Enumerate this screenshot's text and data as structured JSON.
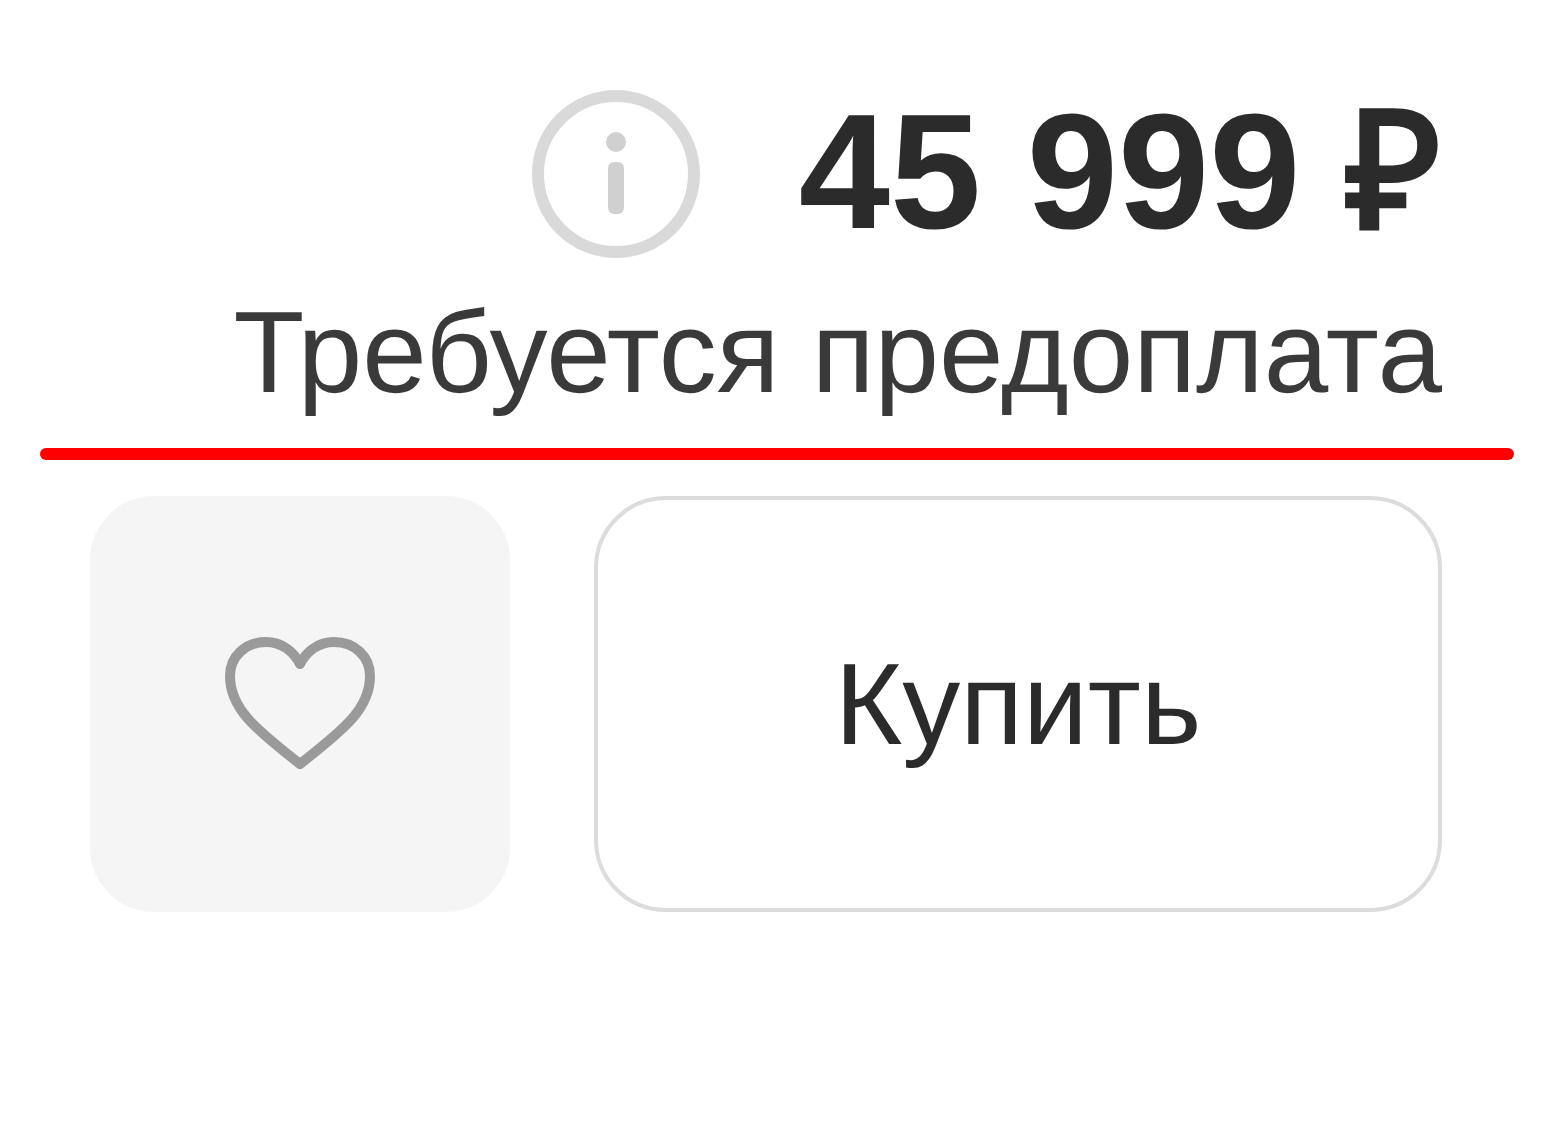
{
  "price": "45 999 ₽",
  "note": "Требуется предоплата",
  "buy_button": {
    "label": "Купить"
  }
}
